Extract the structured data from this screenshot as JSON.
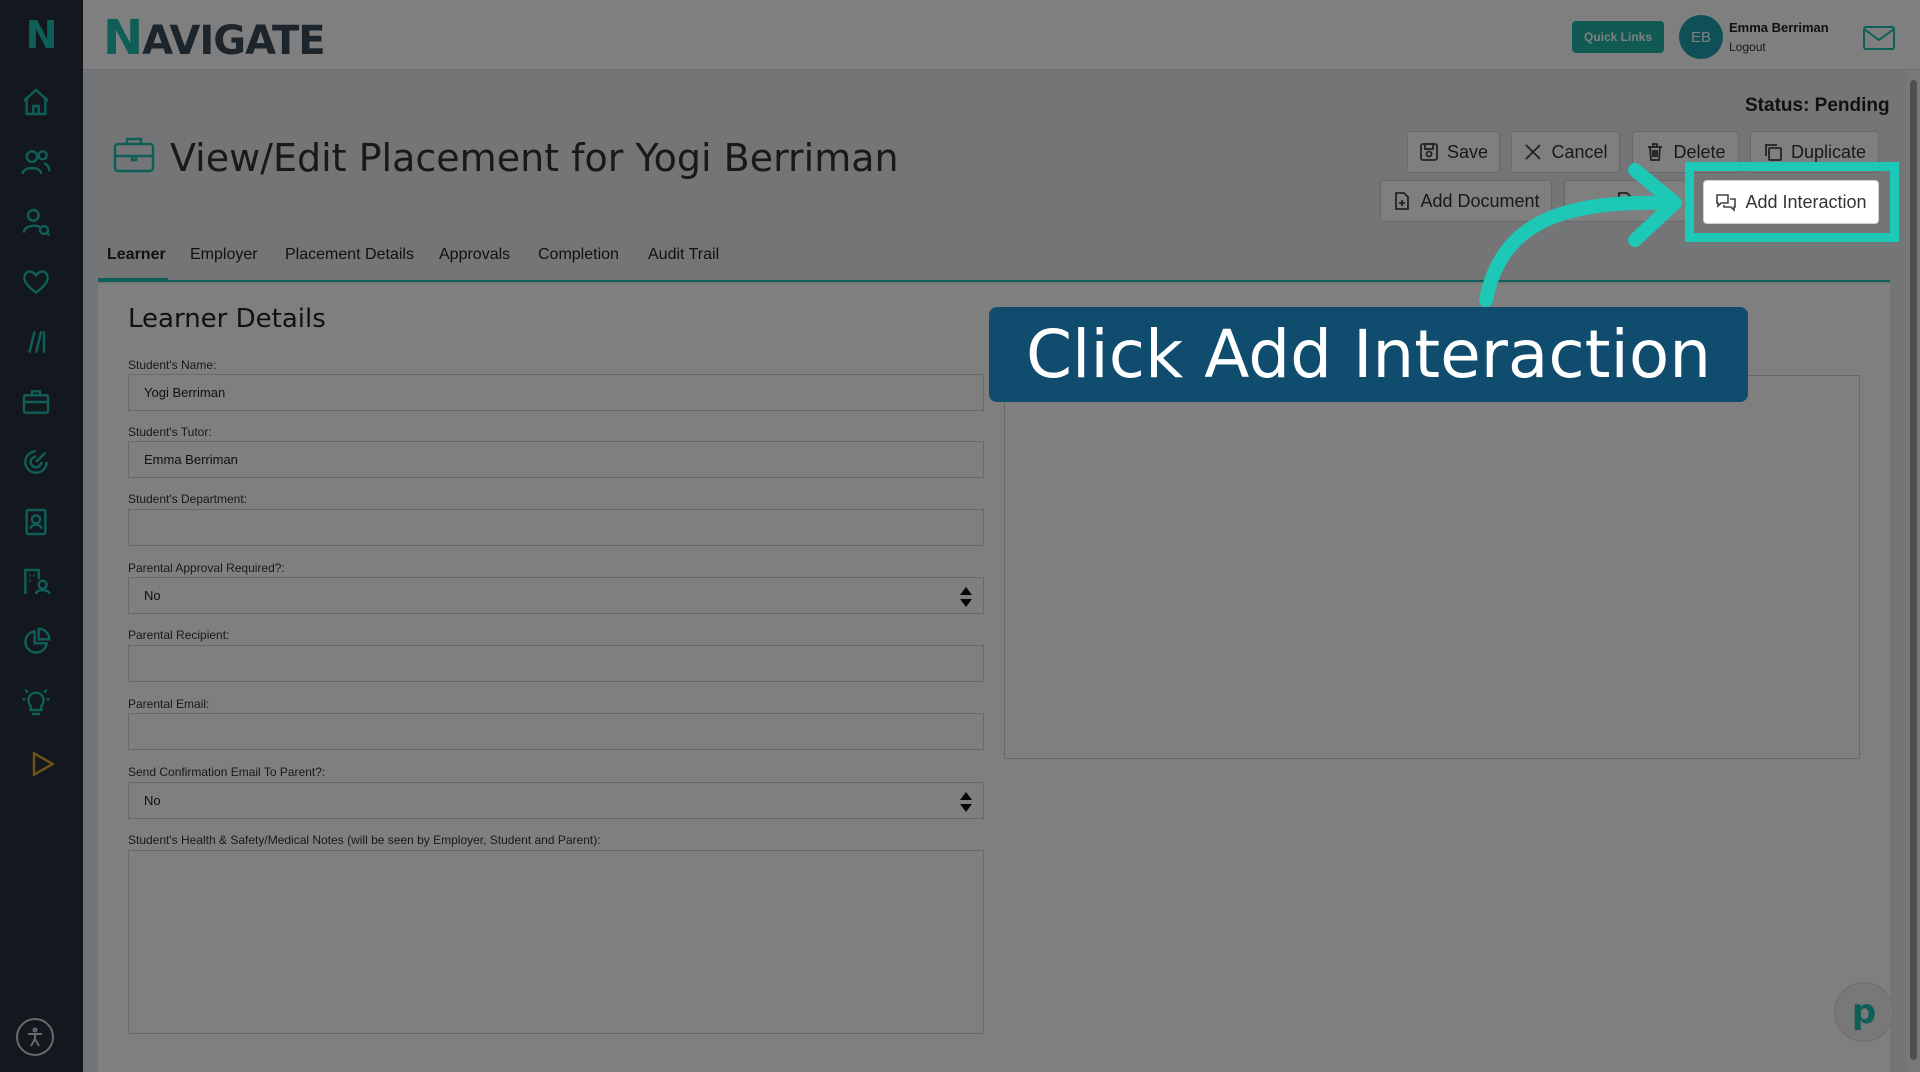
{
  "sidebar": {
    "logo": "N",
    "icons": [
      "home-icon",
      "users-icon",
      "user-search-icon",
      "heart-icon",
      "slashes-icon",
      "briefcase-icon",
      "radar-icon",
      "contact-card-icon",
      "building-user-icon",
      "pie-chart-icon",
      "lightbulb-icon",
      "play-icon"
    ],
    "accessibility_icon": "accessibility-icon"
  },
  "header": {
    "brand_first": "N",
    "brand_rest": "AVIGATE",
    "quick_links": "Quick Links",
    "avatar_initials": "EB",
    "user_name": "Emma Berriman",
    "logout": "Logout"
  },
  "status": "Status: Pending",
  "page_title": "View/Edit Placement for Yogi Berriman",
  "actions": {
    "save": "Save",
    "cancel": "Cancel",
    "delete": "Delete",
    "duplicate": "Duplicate",
    "add_document": "Add Document",
    "add_interaction": "Add Interaction"
  },
  "tabs": [
    "Learner",
    "Employer",
    "Placement Details",
    "Approvals",
    "Completion",
    "Audit Trail"
  ],
  "section_title": "Learner Details",
  "fields": {
    "name_label": "Student's Name:",
    "name_value": "Yogi Berriman",
    "tutor_label": "Student's Tutor:",
    "tutor_value": "Emma Berriman",
    "department_label": "Student's Department:",
    "department_value": "",
    "parental_approval_label": "Parental Approval Required?:",
    "parental_approval_value": "No",
    "parental_recipient_label": "Parental Recipient:",
    "parental_recipient_value": "",
    "parental_email_label": "Parental Email:",
    "parental_email_value": "",
    "send_confirmation_label": "Send Confirmation Email To Parent?:",
    "send_confirmation_value": "No",
    "medical_notes_label": "Student's Health & Safety/Medical Notes (will be seen by Employer, Student and Parent):"
  },
  "callout": "Click Add Interaction",
  "colors": {
    "accent": "#1fbfb0",
    "sidebar": "#26303c",
    "callout_bg": "#0f4c6e",
    "highlight": "#1ec8b6"
  }
}
